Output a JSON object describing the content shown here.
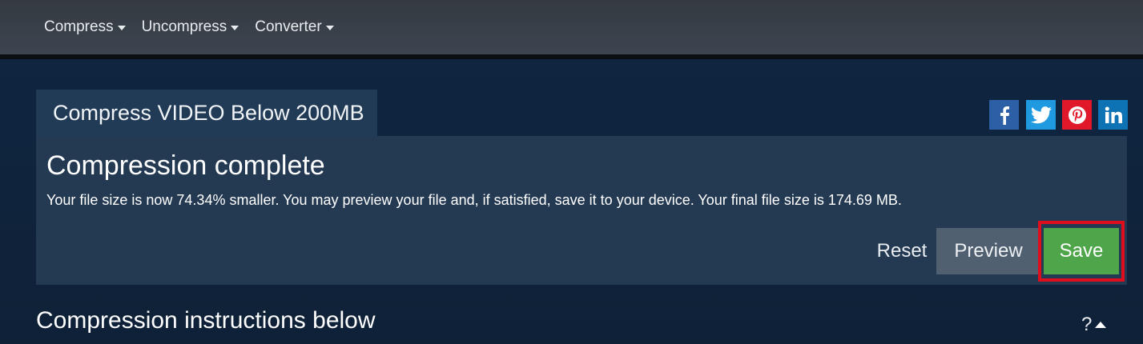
{
  "nav": {
    "items": [
      {
        "label": "Compress"
      },
      {
        "label": "Uncompress"
      },
      {
        "label": "Converter"
      }
    ]
  },
  "tab": {
    "label": "Compress VIDEO Below 200MB"
  },
  "social": {
    "icons": [
      "facebook-icon",
      "twitter-icon",
      "pinterest-icon",
      "linkedin-icon"
    ],
    "colors": {
      "facebook": "#2c5fa5",
      "twitter": "#1f9ae0",
      "pinterest": "#e1182a",
      "linkedin": "#0e73b5"
    }
  },
  "result": {
    "title": "Compression complete",
    "message": "Your file size is now 74.34% smaller. You may preview your file and, if satisfied, save it to your device. Your final file size is 174.69 MB."
  },
  "actions": {
    "reset_label": "Reset",
    "preview_label": "Preview",
    "save_label": "Save"
  },
  "instructions": {
    "title": "Compression instructions below",
    "help_label": "?"
  },
  "colors": {
    "accent_save": "#4ea54a",
    "highlight": "#e00d1c",
    "panel": "#243a53"
  }
}
